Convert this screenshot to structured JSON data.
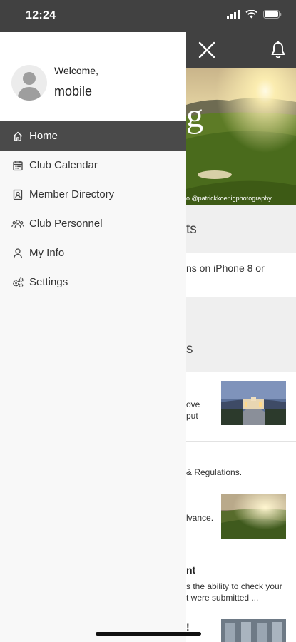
{
  "status_bar": {
    "time": "12:24",
    "icons": [
      "signal-icon",
      "wifi-icon",
      "battery-icon"
    ]
  },
  "drawer": {
    "welcome_label": "Welcome,",
    "username": "mobile",
    "menu": [
      {
        "label": "Home",
        "icon": "home-icon",
        "active": true
      },
      {
        "label": "Club Calendar",
        "icon": "calendar-icon",
        "active": false
      },
      {
        "label": "Member Directory",
        "icon": "contact-card-icon",
        "active": false
      },
      {
        "label": "Club Personnel",
        "icon": "people-icon",
        "active": false
      },
      {
        "label": "My Info",
        "icon": "user-icon",
        "active": false
      },
      {
        "label": "Settings",
        "icon": "gears-icon",
        "active": false
      }
    ]
  },
  "background": {
    "header_icons": [
      "close-icon",
      "bell-icon"
    ],
    "hero_letter": "g",
    "hero_credit": "o @patrickkoenigphotography",
    "section1_title": "ts",
    "section1_text": "ns on iPhone 8 or",
    "section2_title": "s",
    "item1_line1": "ove",
    "item1_line2": "put",
    "item2_text": "& Regulations.",
    "item3_text": "lvance.",
    "item4_title": "nt",
    "item4_line1": "s the ability to check your",
    "item4_line2": "t were submitted ...",
    "item5_title": "!"
  },
  "colors": {
    "header": "#414141",
    "drawer_bg": "#f8f8f8",
    "active_item": "#4a4a4a"
  }
}
